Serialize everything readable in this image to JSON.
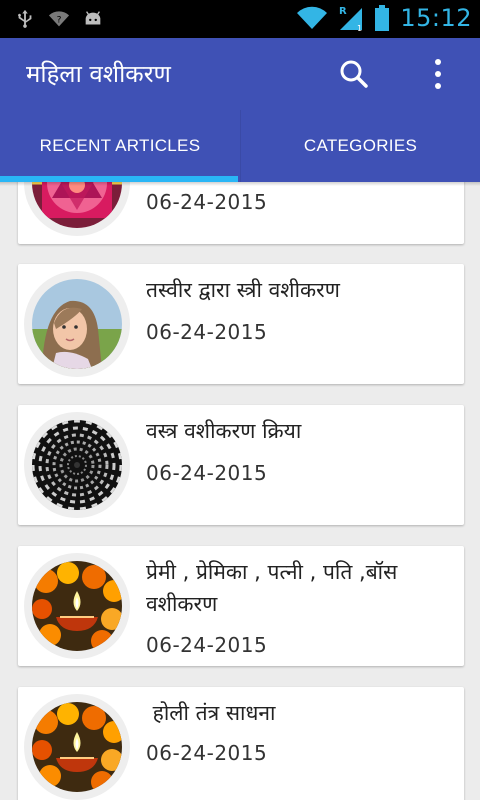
{
  "status_bar": {
    "time": "15:12",
    "icons": [
      "usb-icon",
      "wifi-question-icon",
      "android-icon",
      "wifi-icon",
      "signal-roaming-icon",
      "battery-icon"
    ]
  },
  "app_bar": {
    "title": "महिला वशीकरण",
    "color": "#3f51b5",
    "indicator_color": "#29b6f6"
  },
  "tabs": [
    {
      "label": "RECENT ARTICLES",
      "selected": true
    },
    {
      "label": "CATEGORIES",
      "selected": false
    }
  ],
  "articles": [
    {
      "title": "",
      "date": "06-24-2015",
      "image": "yantra"
    },
    {
      "title": "तस्वीर द्वारा स्त्री वशीकरण",
      "date": "06-24-2015",
      "image": "girl-photo"
    },
    {
      "title": "वस्त्र वशीकरण क्रिया",
      "date": "06-24-2015",
      "image": "hypnotic-spiral"
    },
    {
      "title": "प्रेमी , प्रेमिका , पत्नी , पति ,बॉस वशीकरण",
      "date": "06-24-2015",
      "image": "diya-flowers"
    },
    {
      "title": " होली तंत्र साधना",
      "date": "06-24-2015",
      "image": "diya-flowers"
    }
  ]
}
